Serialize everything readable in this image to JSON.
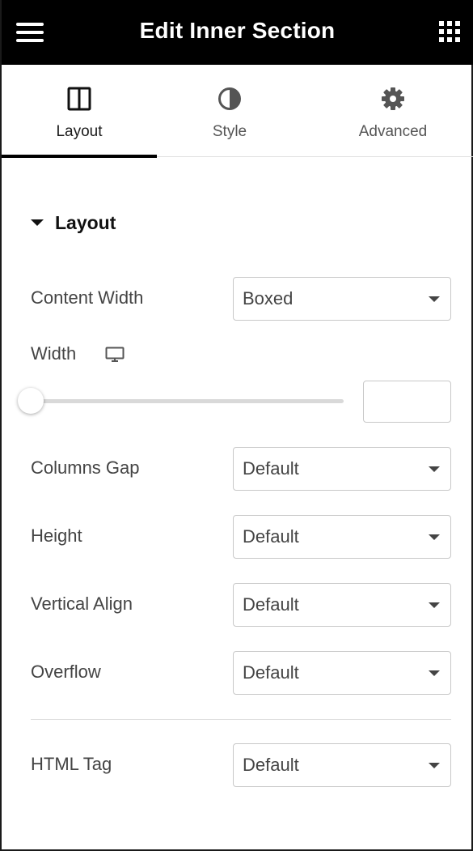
{
  "header": {
    "title": "Edit Inner Section"
  },
  "tabs": [
    {
      "label": "Layout",
      "icon": "columns-icon",
      "active": true
    },
    {
      "label": "Style",
      "icon": "half-circle-icon",
      "active": false
    },
    {
      "label": "Advanced",
      "icon": "gear-icon",
      "active": false
    }
  ],
  "section": {
    "title": "Layout",
    "expanded": true
  },
  "controls": {
    "content_width": {
      "label": "Content Width",
      "value": "Boxed"
    },
    "width": {
      "label": "Width",
      "device_icon": "monitor-icon",
      "slider_value": 0,
      "input_value": ""
    },
    "columns_gap": {
      "label": "Columns Gap",
      "value": "Default"
    },
    "height": {
      "label": "Height",
      "value": "Default"
    },
    "vertical_align": {
      "label": "Vertical Align",
      "value": "Default"
    },
    "overflow": {
      "label": "Overflow",
      "value": "Default"
    },
    "html_tag": {
      "label": "HTML Tag",
      "value": "Default"
    }
  },
  "colors": {
    "header_bg": "#000000",
    "active_tab_underline": "#000000",
    "text": "#444444"
  }
}
